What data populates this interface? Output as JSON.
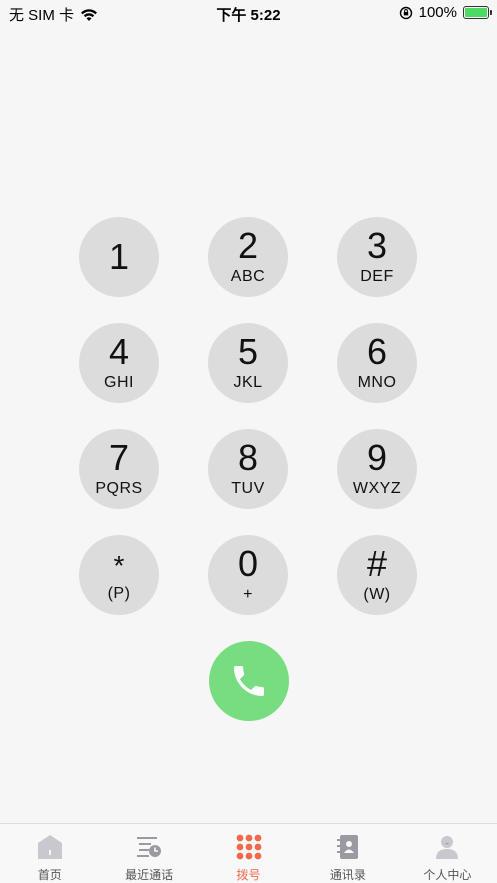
{
  "status_bar": {
    "carrier": "无 SIM 卡",
    "time": "下午 5:22",
    "battery": "100%"
  },
  "keypad": [
    {
      "digit": "1",
      "letters": ""
    },
    {
      "digit": "2",
      "letters": "ABC"
    },
    {
      "digit": "3",
      "letters": "DEF"
    },
    {
      "digit": "4",
      "letters": "GHI"
    },
    {
      "digit": "5",
      "letters": "JKL"
    },
    {
      "digit": "6",
      "letters": "MNO"
    },
    {
      "digit": "7",
      "letters": "PQRS"
    },
    {
      "digit": "8",
      "letters": "TUV"
    },
    {
      "digit": "9",
      "letters": "WXYZ"
    },
    {
      "digit": "*",
      "letters": "(P)"
    },
    {
      "digit": "0",
      "letters": "+"
    },
    {
      "digit": "#",
      "letters": "(W)"
    }
  ],
  "colors": {
    "call_button": "#78dc80",
    "key_bg": "#dcdcdc",
    "active_tab": "#ee6a4b"
  },
  "tabs": [
    {
      "label": "首页",
      "icon": "home-icon"
    },
    {
      "label": "最近通话",
      "icon": "recent-calls-icon"
    },
    {
      "label": "拨号",
      "icon": "dialpad-icon",
      "active": true
    },
    {
      "label": "通讯录",
      "icon": "contacts-icon"
    },
    {
      "label": "个人中心",
      "icon": "profile-icon"
    }
  ]
}
